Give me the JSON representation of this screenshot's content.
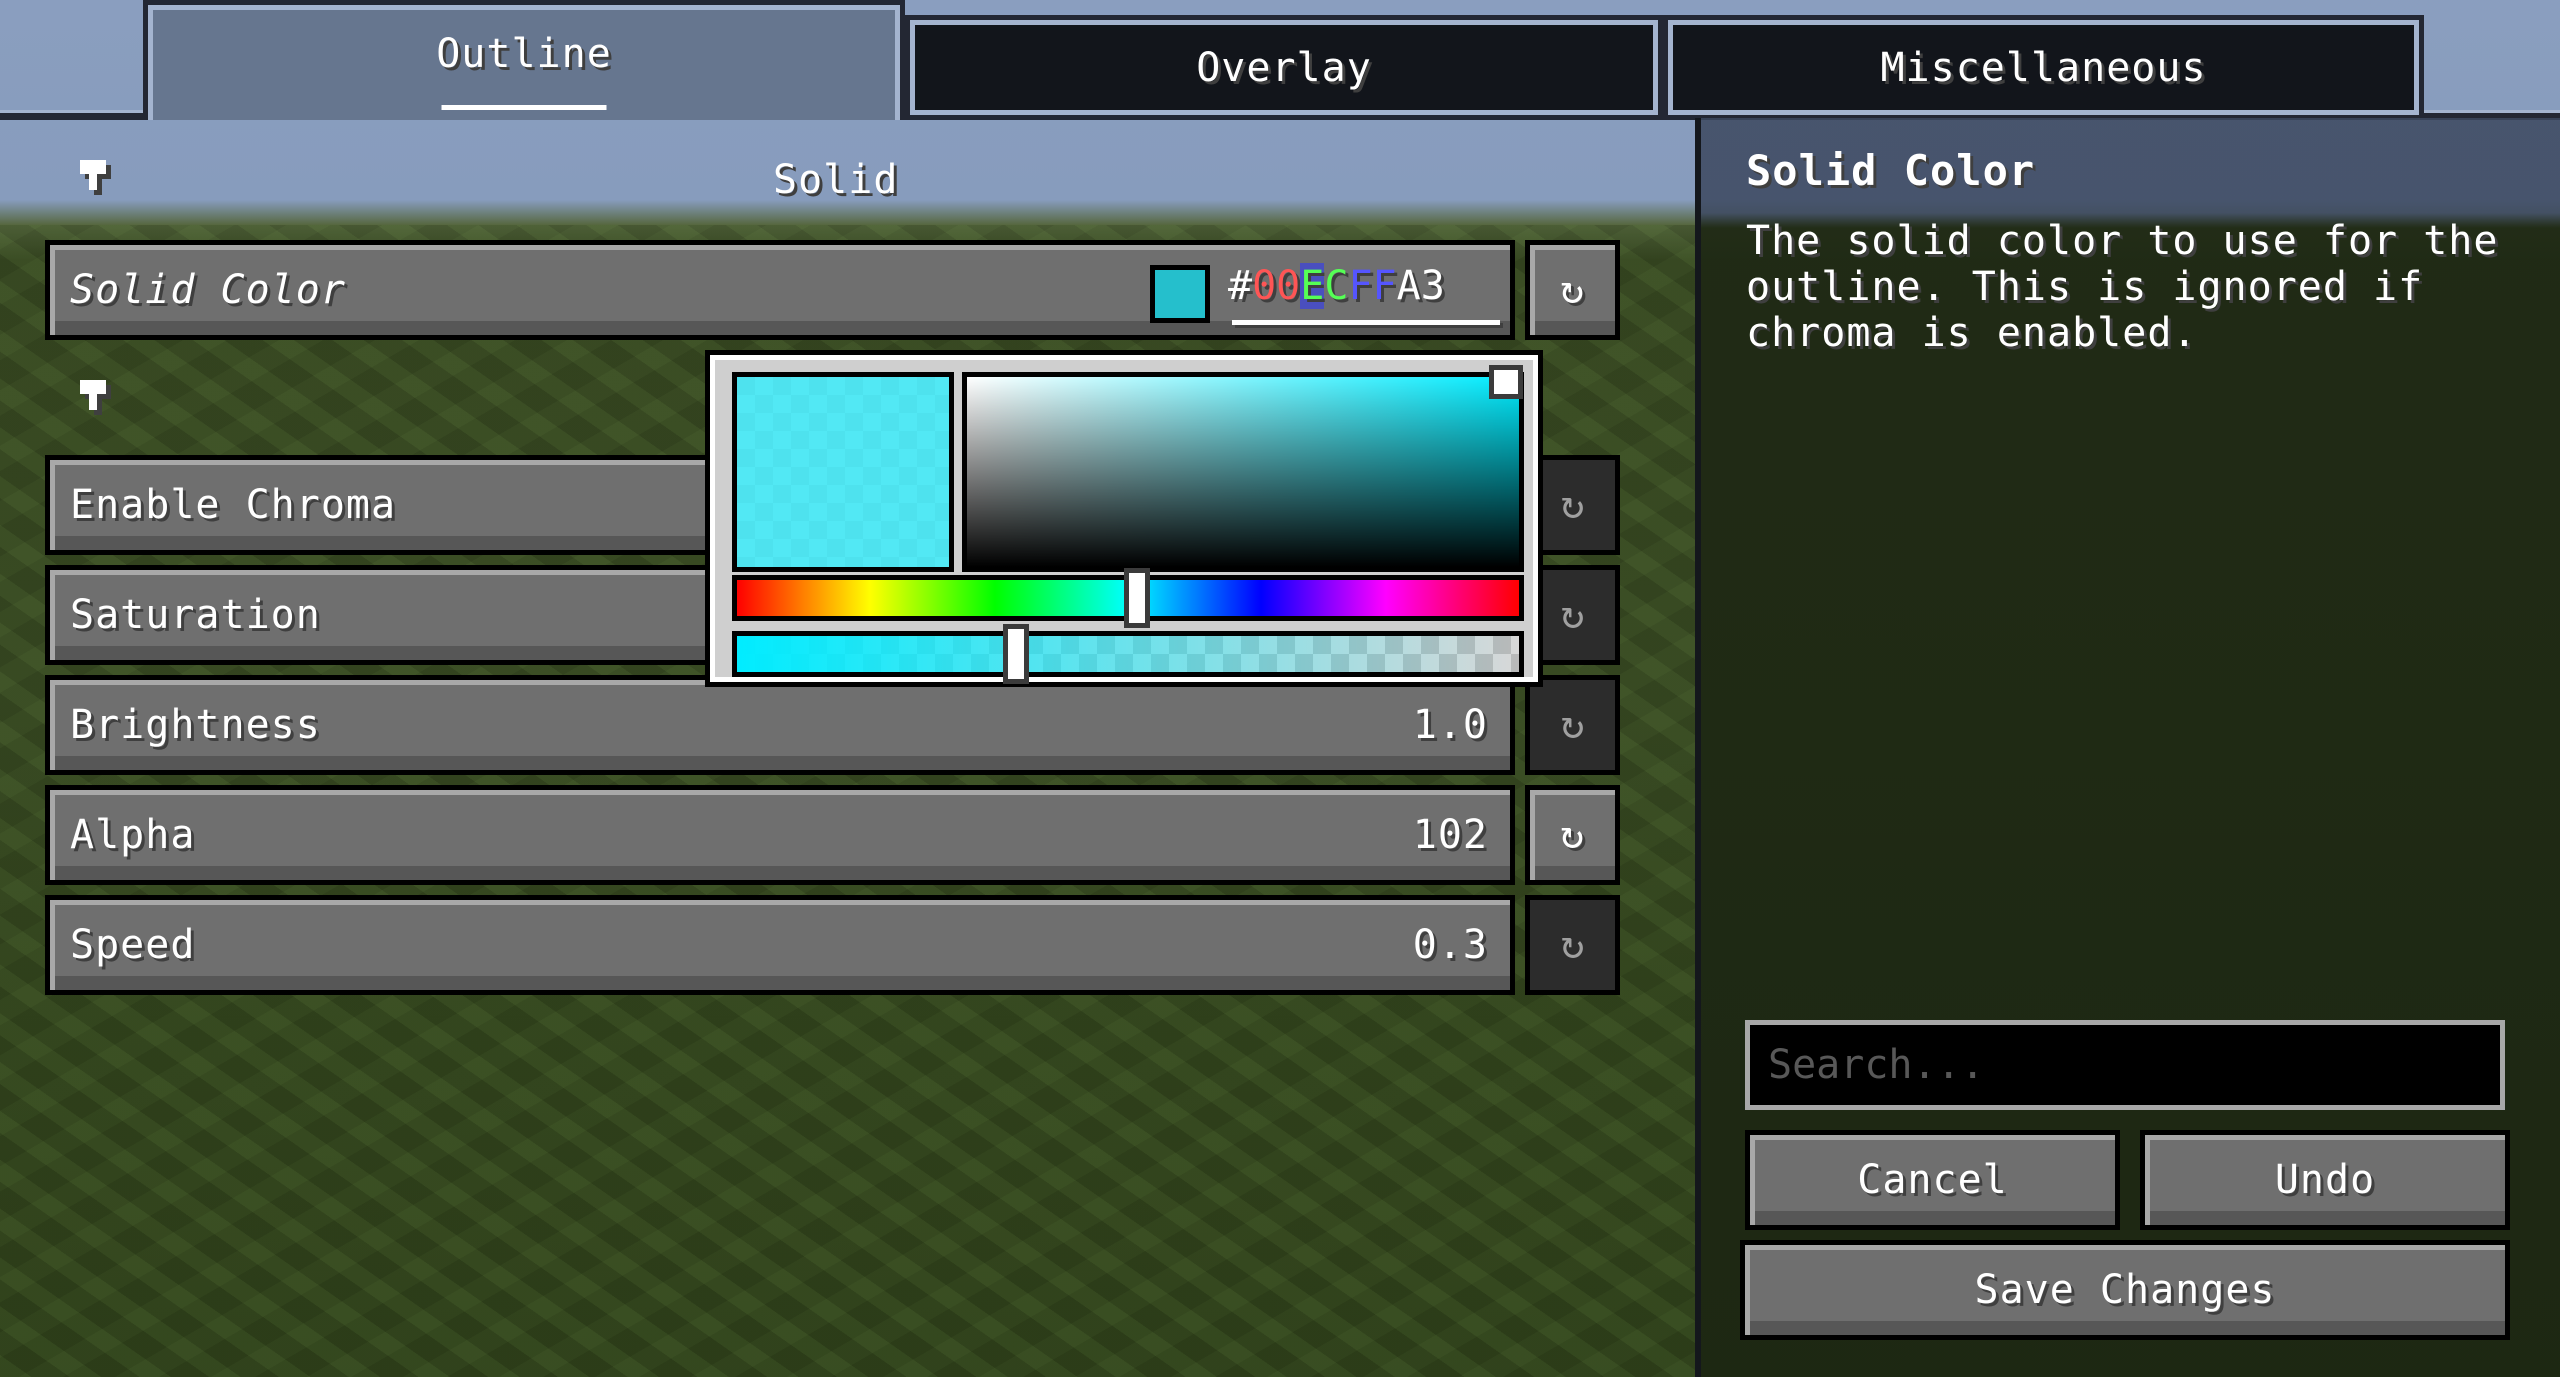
{
  "tabs": [
    {
      "label": "Outline",
      "active": true
    },
    {
      "label": "Overlay",
      "active": false
    },
    {
      "label": "Miscellaneous",
      "active": false
    }
  ],
  "sections": [
    {
      "title": "Solid"
    },
    {
      "title": ""
    }
  ],
  "settings": {
    "solid_color": {
      "label": "Solid Color",
      "hex_prefix": "#",
      "hex_r": "00",
      "hex_g_sel": "E",
      "hex_g_rest": "C",
      "hex_b": "FF",
      "hex_a": "A3",
      "swatch": "#25bfcc",
      "reset_enabled": true
    },
    "enable_chroma": {
      "label": "Enable Chroma",
      "reset_enabled": false
    },
    "saturation": {
      "label": "Saturation",
      "reset_enabled": false
    },
    "brightness": {
      "label": "Brightness",
      "value": "1.0",
      "reset_enabled": false
    },
    "alpha": {
      "label": "Alpha",
      "value": "102",
      "reset_enabled": true
    },
    "speed": {
      "label": "Speed",
      "value": "0.3",
      "reset_enabled": false
    }
  },
  "color_picker": {
    "color": "#00ECFF",
    "hue_fraction": 0.515,
    "saturation": 1.0,
    "value": 1.0,
    "alpha_slider_fraction": 0.36
  },
  "reset_icon": "reset-arrow-icon",
  "info_panel": {
    "title": "Solid Color",
    "description": "The solid color to use for the outline. This is ignored if chroma is enabled."
  },
  "search": {
    "placeholder": "Search...",
    "value": ""
  },
  "buttons": {
    "cancel": "Cancel",
    "undo": "Undo",
    "save": "Save Changes"
  },
  "colors": {
    "hex_red": "#ff5555",
    "hex_green": "#55ff55",
    "hex_blue": "#5555ff",
    "hex_white": "#ffffff"
  }
}
